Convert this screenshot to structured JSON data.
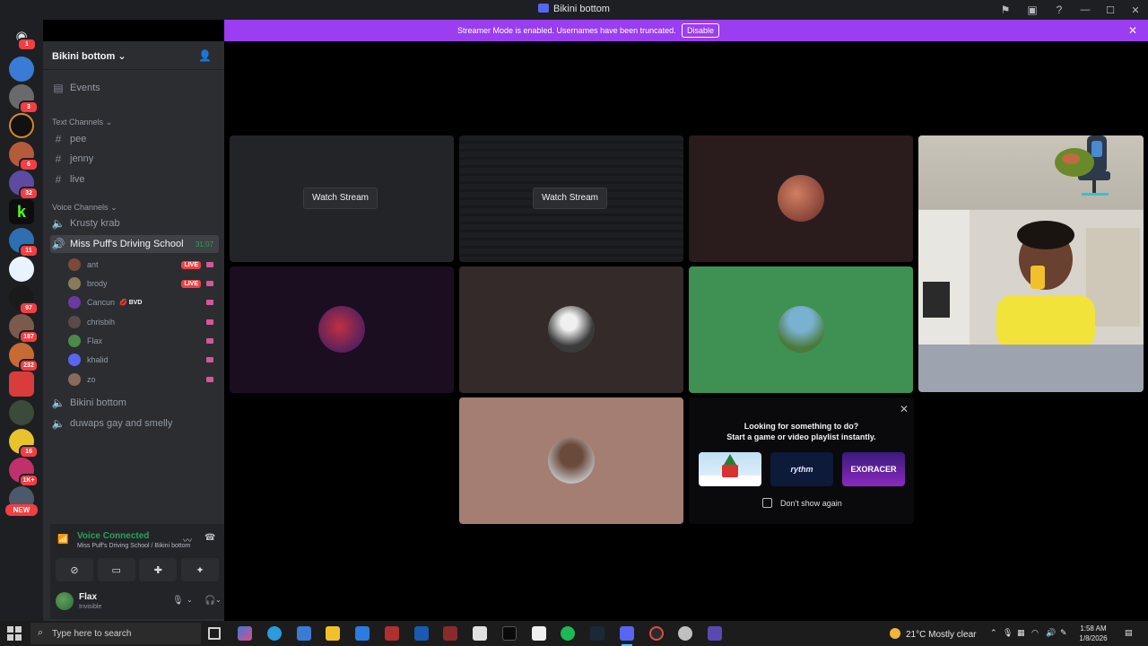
{
  "window": {
    "title": "Bikini bottom"
  },
  "banner": {
    "text": "Streamer Mode is enabled. Usernames have been truncated.",
    "button": "Disable"
  },
  "rail": {
    "badges": [
      "1",
      "3",
      "6",
      "32",
      "11",
      "97",
      "187",
      "232",
      "16",
      "1K+"
    ],
    "new_label": "NEW"
  },
  "server": {
    "name": "Bikini bottom",
    "events_label": "Events",
    "text_category": "Text Channels",
    "text_channels": [
      "pee",
      "jenny",
      "live"
    ],
    "voice_category": "Voice Channels",
    "voice_channels": [
      "Krusty krab",
      "Miss Puff's Driving School",
      "Bikini bottom",
      "duwaps gay and smelly"
    ],
    "active_timer": "31:07",
    "voice_users": [
      {
        "name": "ant",
        "badge": "LIVE"
      },
      {
        "name": "brody",
        "badge": "LIVE"
      },
      {
        "name": "Cancun",
        "status": "💋 BVD"
      },
      {
        "name": "chrisbih"
      },
      {
        "name": "Flax"
      },
      {
        "name": "khalid"
      },
      {
        "name": "zo"
      }
    ]
  },
  "voice_panel": {
    "status": "Voice Connected",
    "location": "Miss Puff's Driving School / Bikini bottom"
  },
  "user": {
    "name": "Flax",
    "status": "Invisible"
  },
  "stage": {
    "watch_stream": "Watch Stream",
    "watch_stream_2": "Watch Stream"
  },
  "activity": {
    "title": "Looking for something to do?",
    "subtitle": "Start a game or video playlist instantly.",
    "thumb_2": "rythm",
    "thumb_3": "EXORACER",
    "checkbox_label": "Don't show again"
  },
  "taskbar": {
    "search_placeholder": "Type here to search",
    "weather": "21°C  Mostly clear",
    "time": "1:58 AM",
    "date": "1/8/2026"
  },
  "colors": {
    "banner": "#9b3df0",
    "connected": "#23a559",
    "live": "#ed4245",
    "tile_green": "#3e9152"
  }
}
